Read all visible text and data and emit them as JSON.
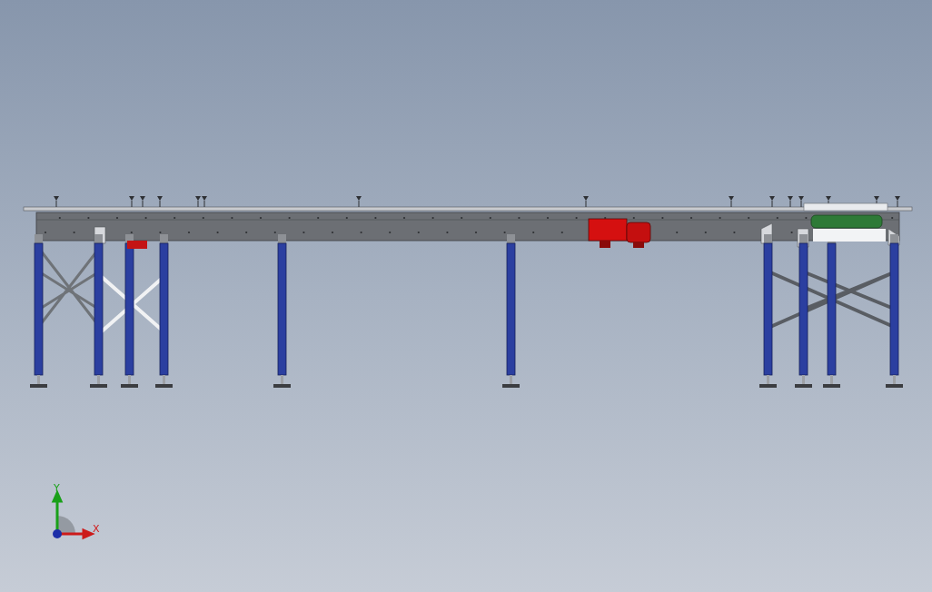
{
  "viewport": {
    "axis_labels": [
      {
        "kind": "y",
        "label": "Y"
      },
      {
        "kind": "x",
        "label": "X"
      }
    ]
  }
}
